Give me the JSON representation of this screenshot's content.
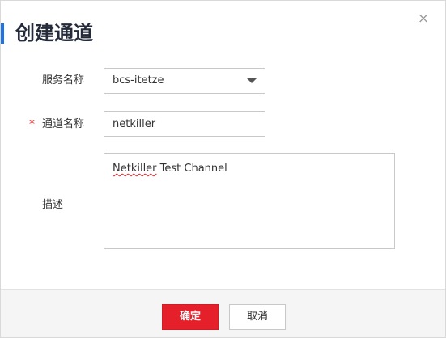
{
  "dialog": {
    "title": "创建通道",
    "close_glyph": "×",
    "accent_color": "#1e73e8"
  },
  "form": {
    "service_name": {
      "label": "服务名称",
      "selected": "bcs-itetze"
    },
    "channel_name": {
      "required_mark": "*",
      "label": "通道名称",
      "value": "netkiller"
    },
    "description": {
      "label": "描述",
      "value_misspelled": "Netkiller",
      "value_rest": " Test Channel"
    }
  },
  "footer": {
    "confirm_label": "确定",
    "cancel_label": "取消",
    "confirm_color": "#e5202a"
  },
  "icons": {
    "close": "close-icon",
    "dropdown": "chevron-down-icon"
  }
}
